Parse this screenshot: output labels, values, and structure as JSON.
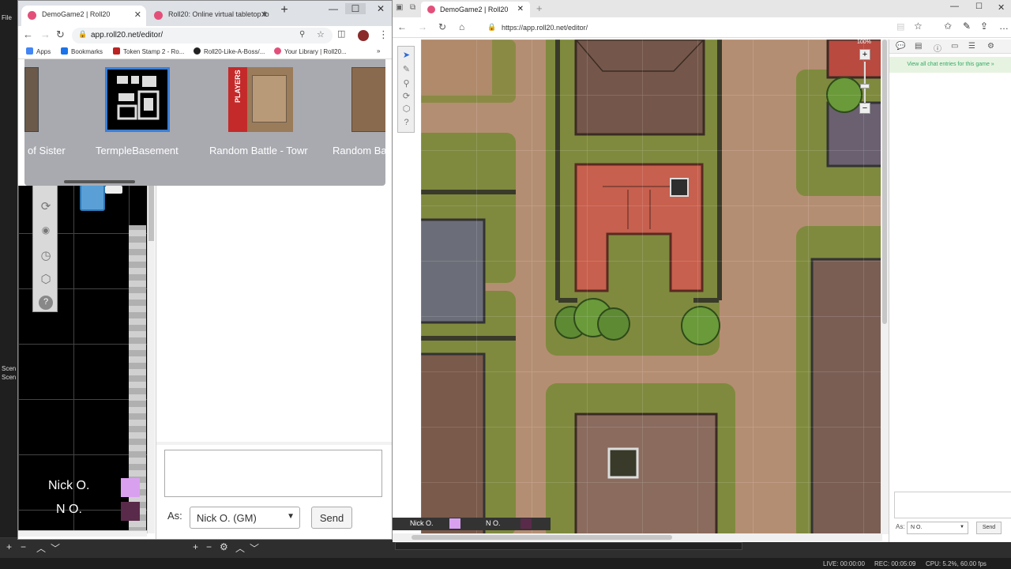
{
  "obs": {
    "left_strip": [
      "File",
      "Scen",
      "Scen"
    ],
    "status": {
      "live": "LIVE: 00:00:00",
      "rec": "REC: 00:05:09",
      "cpu": "CPU: 5.2%, 60.00 fps"
    }
  },
  "chrome": {
    "tabs": [
      {
        "label": "DemoGame2 | Roll20",
        "active": true
      },
      {
        "label": "Roll20: Online virtual tabletop fo",
        "active": false
      }
    ],
    "url": "app.roll20.net/editor/",
    "bookmarks": [
      "Apps",
      "Bookmarks",
      "Token Stamp 2 - Ro...",
      "Roll20-Like-A-Boss/...",
      "Your Library | Roll20..."
    ],
    "pages": [
      {
        "label": "of Sister",
        "thumb": "gray-map"
      },
      {
        "label": "TermpleBasement",
        "thumb": "dungeon",
        "selected": true
      },
      {
        "label": "Random Battle - Towr",
        "thumb": "players-banner"
      },
      {
        "label": "Random Bat",
        "thumb": "house"
      }
    ],
    "players_banner_text": "PLAYERS",
    "players": [
      {
        "name": "Nick O.",
        "color": "#d9a0f0"
      },
      {
        "name": "N O.",
        "color": "#5a2a4a"
      }
    ],
    "chat": {
      "as_label": "As:",
      "speaking_as": "Nick O. (GM)",
      "send_label": "Send"
    }
  },
  "edge": {
    "tab_label": "DemoGame2 | Roll20",
    "url": "https://app.roll20.net/editor/",
    "zoom_label": "100%",
    "view_chat_label": "View all chat entries for this game »",
    "players": [
      {
        "name": "Nick O.",
        "color": "#d9a0f0"
      },
      {
        "name": "N O.",
        "color": "#5a2a4a"
      }
    ],
    "chat": {
      "as_label": "As:",
      "speaking_as": "N O.",
      "send_label": "Send"
    }
  }
}
